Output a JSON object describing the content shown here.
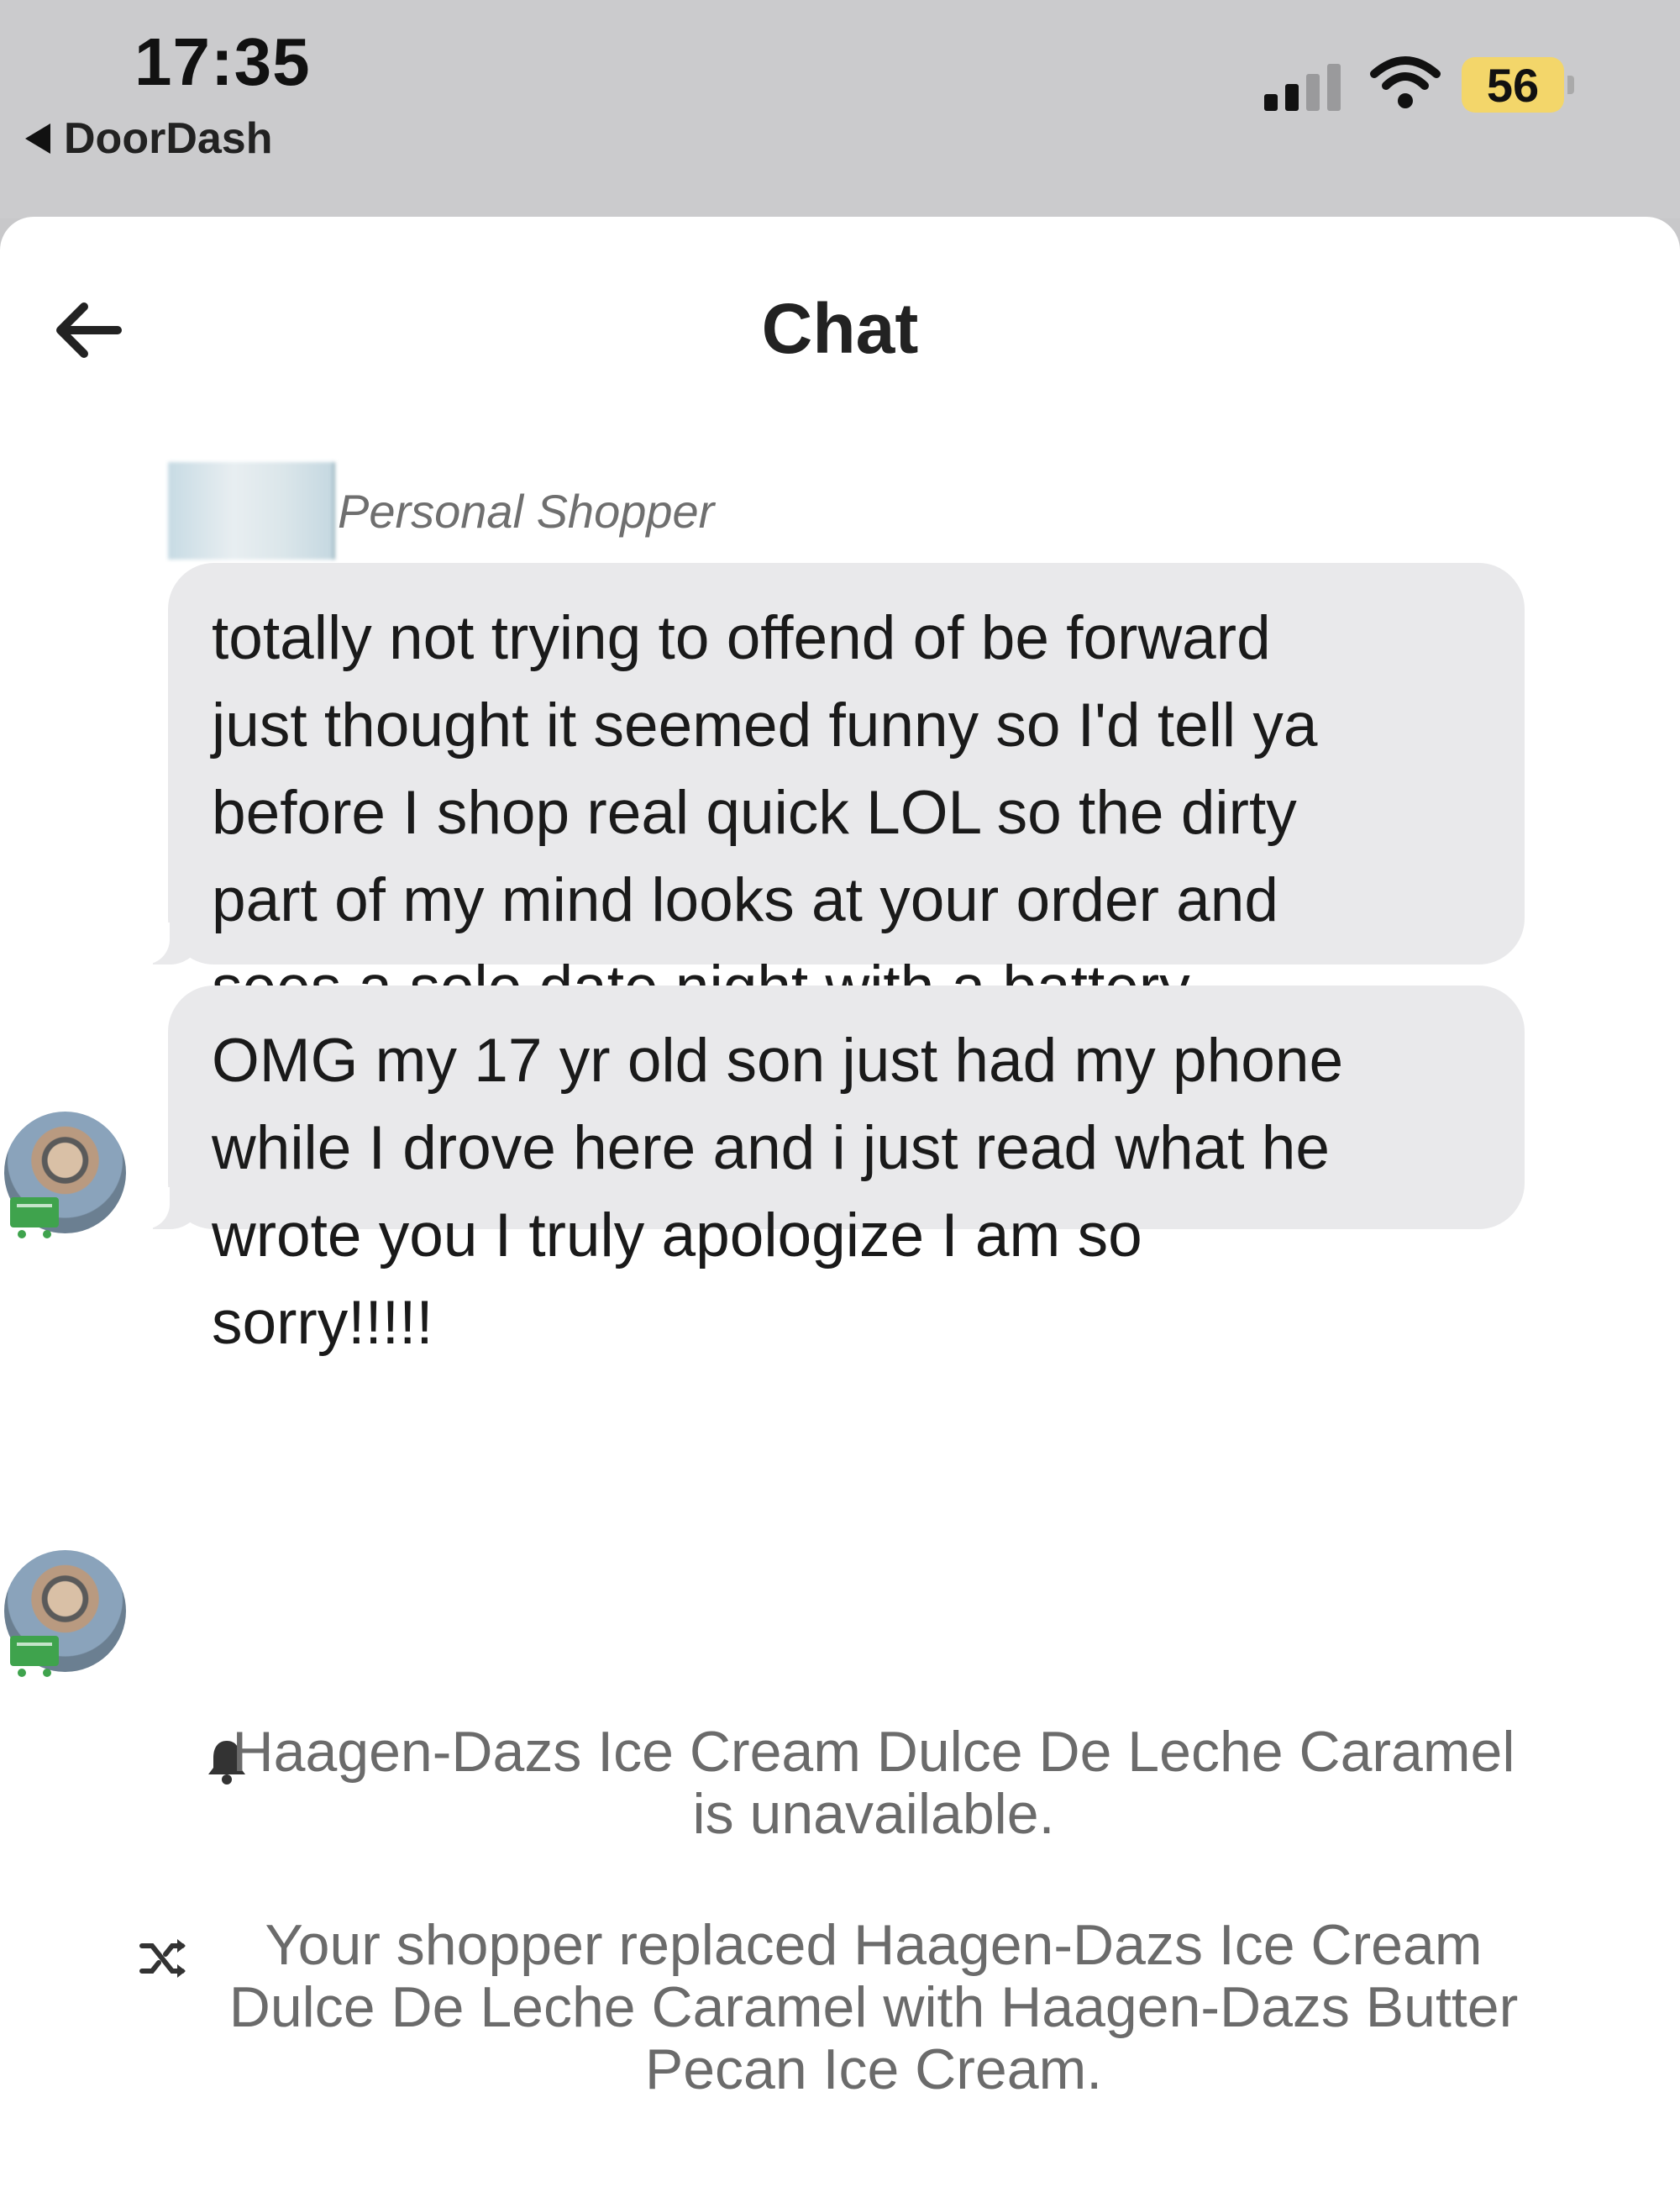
{
  "status_bar": {
    "time": "17:35",
    "back_app_label": "DoorDash",
    "battery": "56",
    "icons": [
      "signal-icon",
      "wifi-icon",
      "battery-icon"
    ]
  },
  "header": {
    "title": "Chat",
    "back_icon": "arrow-left-icon"
  },
  "sender": {
    "role_label": "Personal Shopper"
  },
  "messages": [
    {
      "text": "totally not trying to offend of be forward\njust thought it seemed funny so I'd tell ya\nbefore I shop real quick LOL so the dirty\npart of my mind looks at your order and\nsees a solo date night with a battery\noperated buddy lol not saying there's\nanything wrong with that if so... hahahah"
    },
    {
      "text": "OMG my 17 yr old son just had my phone\nwhile I drove here and i just read what he\nwrote you I truly apologize I am so\nsorry!!!!!"
    }
  ],
  "system_messages": [
    {
      "icon": "bell-icon",
      "text": "Haagen-Dazs Ice Cream Dulce De Leche Caramel is unavailable."
    },
    {
      "icon": "shuffle-icon",
      "text": "Your shopper replaced Haagen-Dazs Ice Cream Dulce De Leche Caramel with Haagen-Dazs Butter Pecan Ice Cream."
    }
  ],
  "colors": {
    "bubble": "#e9e9eb",
    "status_bar": "#cbcbcd",
    "battery": "#f3d66a",
    "cart_badge": "#3fa34d"
  }
}
